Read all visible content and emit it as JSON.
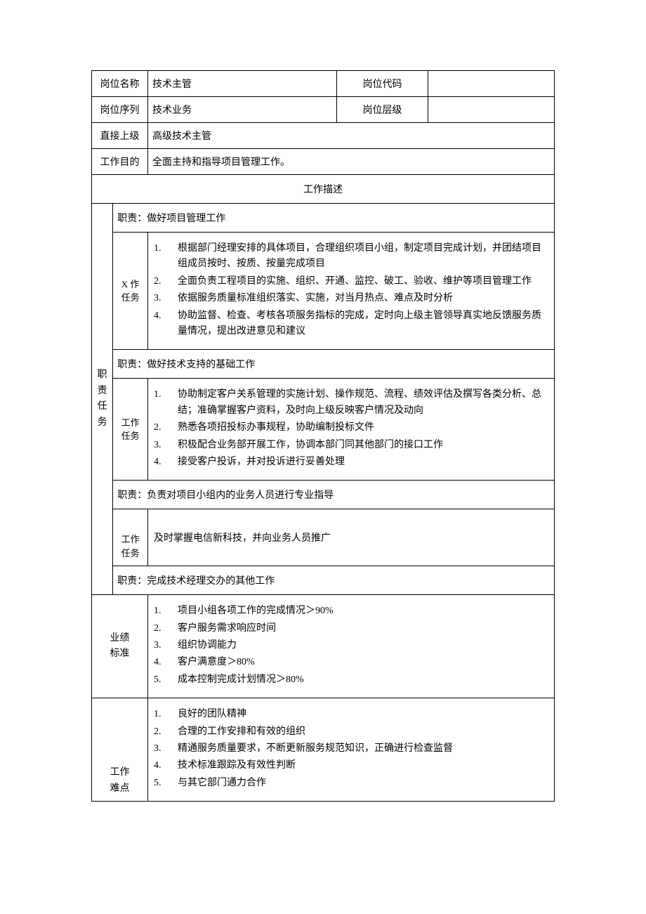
{
  "headers": {
    "position_name_label": "岗位名称",
    "position_name_value": "技术主管",
    "position_code_label": "岗位代码",
    "position_code_value": "",
    "position_series_label": "岗位序列",
    "position_series_value": "技术业务",
    "position_level_label": "岗位层级",
    "position_level_value": "",
    "direct_superior_label": "直接上级",
    "direct_superior_value": "高级技术主管",
    "work_purpose_label": "工作目的",
    "work_purpose_value": "全面主持和指导项目管理工作。"
  },
  "work_desc_title": "工作描述",
  "duty_section_label": "职 责 任 务",
  "task_label": "工作任务",
  "task_label_x": "X 作任务",
  "duties": {
    "d1_title": "职责：做好项目管理工作",
    "d1_items": [
      "根据部门经理安排的具体项目，合理组织项目小组，制定项目完成计划，并团结项目组成员按时、按质、按量完成项目",
      "全面负责工程项目的实施、组织、开通、监控、破工、验收、维护等项目管理工作",
      "依据服务质量标准组织落实、实施，对当月热点、难点及时分析",
      "协助监督、检查、考核各项服务指标的完成，定时向上级主管领导真实地反馈服务质量情况，提出改进意见和建议"
    ],
    "d2_title": "职责：做好技术支持的基础工作",
    "d2_items": [
      "协助制定客户关系管理的实施计划、操作规范、流程、绩效评估及撰写各类分析、总结；准确掌握客户资料，及时向上级反映客户情况及动向",
      "熟悉各项招投标办事规程，协助编制投标文件",
      "积极配合业务部开展工作，协调本部门同其他部门的接口工作",
      "接受客户投诉，并对投诉进行妥善处理"
    ],
    "d3_title": "职责：负责对项目小组内的业务人员进行专业指导",
    "d3_single": "及时掌握电信新科技，并向业务人员推广",
    "d4_title": "职责：完成技术经理交办的其他工作"
  },
  "performance": {
    "label": "业绩标准",
    "items": [
      "项目小组各项工作的完成情况＞90%",
      "客户服务需求响应时间",
      "组织协调能力",
      "客户满意度＞80%",
      "成本控制完成计划情况＞80%"
    ]
  },
  "difficulty": {
    "label": "工作难点",
    "items": [
      "良好的团队精神",
      "合理的工作安排和有效的组织",
      "精通服务质量要求，不断更新服务规范知识，正确进行检查监督",
      "技术标准跟踪及有效性判断",
      "与其它部门通力合作"
    ]
  }
}
